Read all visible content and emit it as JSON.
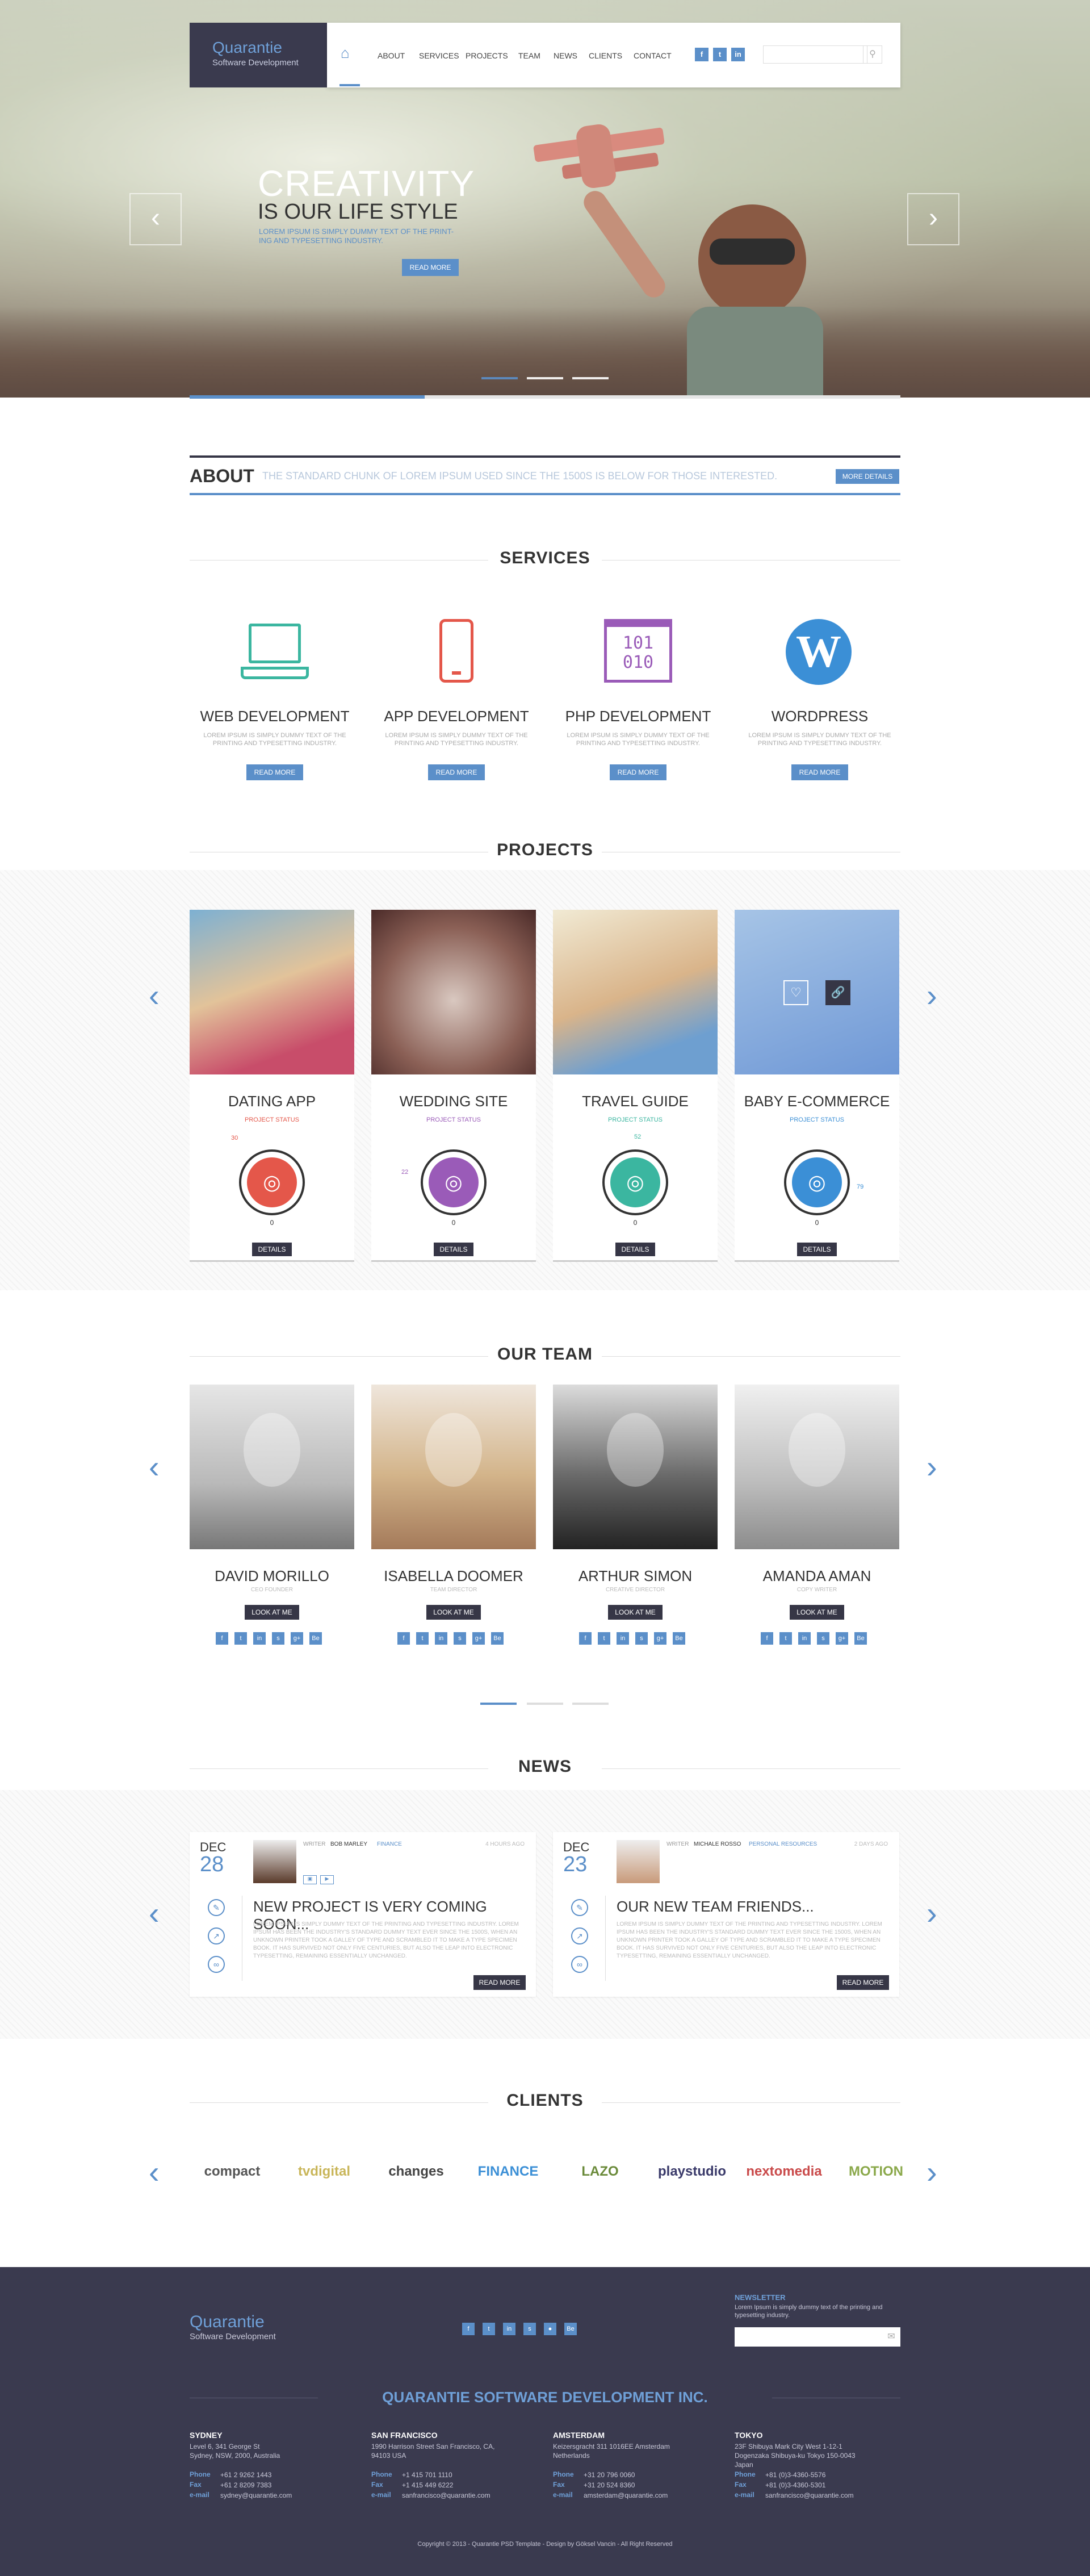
{
  "brand": {
    "name": "Quarantie",
    "tagline": "Software Development"
  },
  "nav": {
    "items": [
      "ABOUT",
      "SERVICES",
      "PROJECTS",
      "TEAM",
      "NEWS",
      "CLIENTS",
      "CONTACT"
    ],
    "search_placeholder": ""
  },
  "hero": {
    "title_line1": "CREATIVITY",
    "title_line2": "IS OUR LIFE STYLE",
    "subtitle": "LOREM IPSUM IS SIMPLY DUMMY TEXT OF THE PRINT-ING AND TYPESETTING INDUSTRY.",
    "button": "READ MORE",
    "slides": 3,
    "active_slide": 1
  },
  "about": {
    "title": "ABOUT",
    "text": "THE STANDARD CHUNK OF LOREM IPSUM USED SINCE THE 1500S IS BELOW FOR THOSE INTERESTED.",
    "button": "MORE DETAILS"
  },
  "services": {
    "title": "SERVICES",
    "items": [
      {
        "title": "WEB DEVELOPMENT",
        "text": "LOREM IPSUM IS SIMPLY DUMMY TEXT OF THE PRINTING AND TYPESETTING INDUSTRY.",
        "button": "READ MORE",
        "color": "#3bb6a0",
        "icon": "laptop-icon"
      },
      {
        "title": "APP DEVELOPMENT",
        "text": "LOREM IPSUM IS SIMPLY DUMMY TEXT OF THE PRINTING AND TYPESETTING INDUSTRY.",
        "button": "READ MORE",
        "color": "#e4574a",
        "icon": "phone-icon"
      },
      {
        "title": "PHP DEVELOPMENT",
        "text": "LOREM IPSUM IS SIMPLY DUMMY TEXT OF THE PRINTING AND TYPESETTING INDUSTRY.",
        "button": "READ MORE",
        "color": "#9a5bb8",
        "icon": "binary-icon",
        "glyph": "101\n010"
      },
      {
        "title": "WORDPRESS",
        "text": "LOREM IPSUM IS SIMPLY DUMMY TEXT OF THE PRINTING AND TYPESETTING INDUSTRY.",
        "button": "READ MORE",
        "color": "#3b8fd6",
        "icon": "wordpress-icon"
      }
    ]
  },
  "projects": {
    "title": "PROJECTS",
    "items": [
      {
        "name": "DATING APP",
        "status": "PROJECT STATUS",
        "status_color": "#e4574a",
        "count": "0",
        "label": "DETAILS",
        "pct": "30",
        "color": "#e4574a",
        "icon": "hearts-icon"
      },
      {
        "name": "WEDDING SITE",
        "status": "PROJECT STATUS",
        "status_color": "#9a5bb8",
        "count": "0",
        "label": "DETAILS",
        "pct": "22",
        "color": "#9a5bb8",
        "icon": "glasses-icon"
      },
      {
        "name": "TRAVEL GUIDE",
        "status": "PROJECT STATUS",
        "status_color": "#3bb6a0",
        "count": "0",
        "label": "DETAILS",
        "pct": "52",
        "color": "#3bb6a0",
        "icon": "ship-icon"
      },
      {
        "name": "BABY E-COMMERCE",
        "status": "PROJECT STATUS",
        "status_color": "#3b8fd6",
        "count": "0",
        "label": "DETAILS",
        "pct": "79",
        "color": "#3b8fd6",
        "icon": "pacifier-icon"
      }
    ]
  },
  "team": {
    "title": "OUR TEAM",
    "members": [
      {
        "name": "DAVID MORILLO",
        "role": "CEO FOUNDER",
        "button": "LOOK AT ME"
      },
      {
        "name": "ISABELLA DOOMER",
        "role": "TEAM DIRECTOR",
        "button": "LOOK AT ME"
      },
      {
        "name": "ARTHUR SIMON",
        "role": "CREATIVE DIRECTOR",
        "button": "LOOK AT ME"
      },
      {
        "name": "AMANDA AMAN",
        "role": "COPY WRITER",
        "button": "LOOK AT ME"
      }
    ]
  },
  "news": {
    "title": "NEWS",
    "items": [
      {
        "month": "DEC",
        "day": "28",
        "author": "BOB MARLEY",
        "category": "FINANCE",
        "time": "4 HOURS AGO",
        "title": "NEW PROJECT IS VERY COMING SOON...",
        "text": "LOREM IPSUM IS SIMPLY DUMMY TEXT OF THE PRINTING AND TYPESETTING INDUSTRY. LOREM IPSUM HAS BEEN THE INDUSTRY'S STANDARD DUMMY TEXT EVER SINCE THE 1500S, WHEN AN UNKNOWN PRINTER TOOK A GALLEY OF TYPE AND SCRAMBLED IT TO MAKE A TYPE SPECIMEN BOOK. IT HAS SURVIVED NOT ONLY FIVE CENTURIES, BUT ALSO THE LEAP INTO ELECTRONIC TYPESETTING, REMAINING ESSENTIALLY UNCHANGED.",
        "button": "READ MORE"
      },
      {
        "month": "DEC",
        "day": "23",
        "author": "MICHALE ROSSO",
        "category": "PERSONAL RESOURCES",
        "time": "2 DAYS AGO",
        "title": "OUR NEW TEAM FRIENDS...",
        "text": "LOREM IPSUM IS SIMPLY DUMMY TEXT OF THE PRINTING AND TYPESETTING INDUSTRY. LOREM IPSUM HAS BEEN THE INDUSTRY'S STANDARD DUMMY TEXT EVER SINCE THE 1500S, WHEN AN UNKNOWN PRINTER TOOK A GALLEY OF TYPE AND SCRAMBLED IT TO MAKE A TYPE SPECIMEN BOOK. IT HAS SURVIVED NOT ONLY FIVE CENTURIES, BUT ALSO THE LEAP INTO ELECTRONIC TYPESETTING, REMAINING ESSENTIALLY UNCHANGED.",
        "button": "READ MORE"
      }
    ]
  },
  "clients": {
    "title": "CLIENTS",
    "items": [
      {
        "name": "compact",
        "color": "#555"
      },
      {
        "name": "tvdigital",
        "color": "#c9b65a"
      },
      {
        "name": "changes",
        "color": "#444"
      },
      {
        "name": "FINANCE",
        "color": "#3b8fd6"
      },
      {
        "name": "LAZO",
        "color": "#6a8a3a"
      },
      {
        "name": "playstudio",
        "color": "#3a3a6a"
      },
      {
        "name": "nextomedia",
        "color": "#c94a4a"
      },
      {
        "name": "MOTION",
        "color": "#8aa84a"
      }
    ]
  },
  "footer": {
    "company": "QUARANTIE SOFTWARE DEVELOPMENT INC.",
    "newsletter_title": "NEWSLETTER",
    "newsletter_text": "Lorem Ipsum is simply dummy text of the printing and typesetting industry.",
    "offices": [
      {
        "city": "SYDNEY",
        "address": "Level 6, 341 George St\nSydney, NSW, 2000, Australia",
        "phone": "+61 2 9262 1443",
        "fax": "+61 2 8209 7383",
        "email": "sydney@quarantie.com"
      },
      {
        "city": "SAN FRANCISCO",
        "address": "1990 Harrison Street San Francisco, CA,\n94103 USA",
        "phone": "+1 415 701 1110",
        "fax": "+1 415 449 6222",
        "email": "sanfrancisco@quarantie.com"
      },
      {
        "city": "AMSTERDAM",
        "address": "Keizersgracht 311 1016EE Amsterdam\nNetherlands",
        "phone": "+31 20 796 0060",
        "fax": "+31 20 524 8360",
        "email": "amsterdam@quarantie.com"
      },
      {
        "city": "TOKYO",
        "address": "23F Shibuya Mark City West 1-12-1\nDogenzaka Shibuya-ku Tokyo 150-0043\nJapan",
        "phone": "+81 (0)3-4360-5576",
        "fax": "+81 (0)3-4360-5301",
        "email": "sanfrancisco@quarantie.com"
      }
    ],
    "labels": {
      "phone": "Phone",
      "fax": "Fax",
      "email": "e-mail"
    },
    "copyright": "Copyright © 2013 - Quarantie PSD Template - Design by Göksel Vancin - All Right Reserved"
  }
}
